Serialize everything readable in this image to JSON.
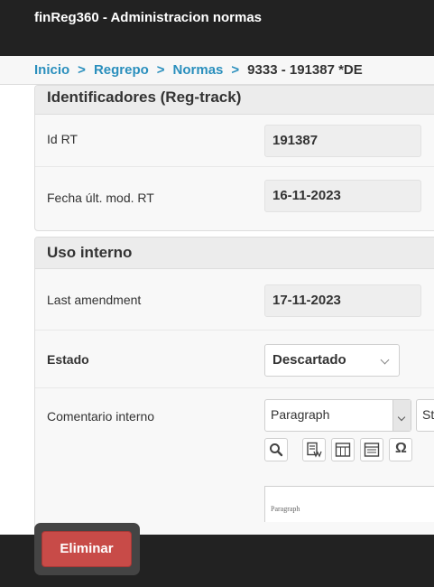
{
  "app": {
    "title": "finReg360 - Administracion normas"
  },
  "breadcrumb": {
    "items": [
      "Inicio",
      "Regrepo",
      "Normas"
    ],
    "separator": ">",
    "current": "9333 - 191387 *DE"
  },
  "panel_identificadores": {
    "title": "Identificadores (Reg-track)",
    "rows": [
      {
        "label": "Id RT",
        "value": "191387"
      },
      {
        "label": "Fecha últ. mod. RT",
        "value": "16-11-2023"
      }
    ]
  },
  "panel_uso_interno": {
    "title": "Uso interno",
    "last_amendment": {
      "label": "Last amendment",
      "value": "17-11-2023"
    },
    "estado": {
      "label": "Estado",
      "value": "Descartado"
    },
    "comentario": {
      "label": "Comentario interno",
      "format_select": "Paragraph",
      "style_select": "St",
      "toolbar_icons": [
        "find-replace-icon",
        "spellcheck-icon",
        "insert-table-icon",
        "insert-template-icon",
        "special-character-icon"
      ],
      "omega_glyph": "Ω",
      "editor_preview": "Paragraph"
    }
  },
  "footer": {
    "delete_label": "Eliminar"
  },
  "colors": {
    "topbar": "#222222",
    "link": "#2a8fbd",
    "danger": "#c84b48"
  }
}
